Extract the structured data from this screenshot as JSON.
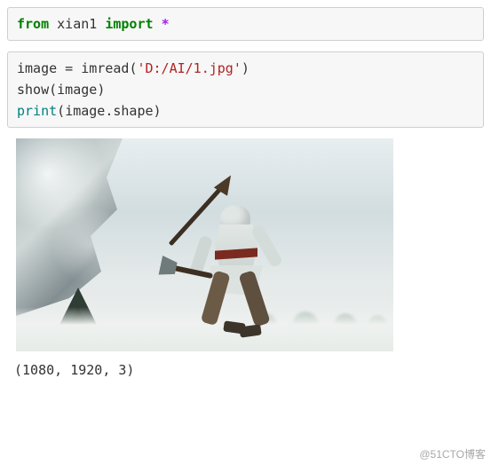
{
  "code_cell_1": {
    "kw_from": "from",
    "module": "xian1",
    "kw_import": "import",
    "star": "*"
  },
  "code_cell_2": {
    "line1_var": "image",
    "line1_eq": " = ",
    "line1_fn": "imread",
    "line1_open": "(",
    "line1_str": "'D:/AI/1.jpg'",
    "line1_close": ")",
    "line2_fn": "show",
    "line2_open": "(",
    "line2_arg": "image",
    "line2_close": ")",
    "line3_fn": "print",
    "line3_open": "(",
    "line3_arg": "image.shape",
    "line3_close": ")"
  },
  "output_text": "(1080, 1920, 3)",
  "watermark": "@51CTO博客"
}
